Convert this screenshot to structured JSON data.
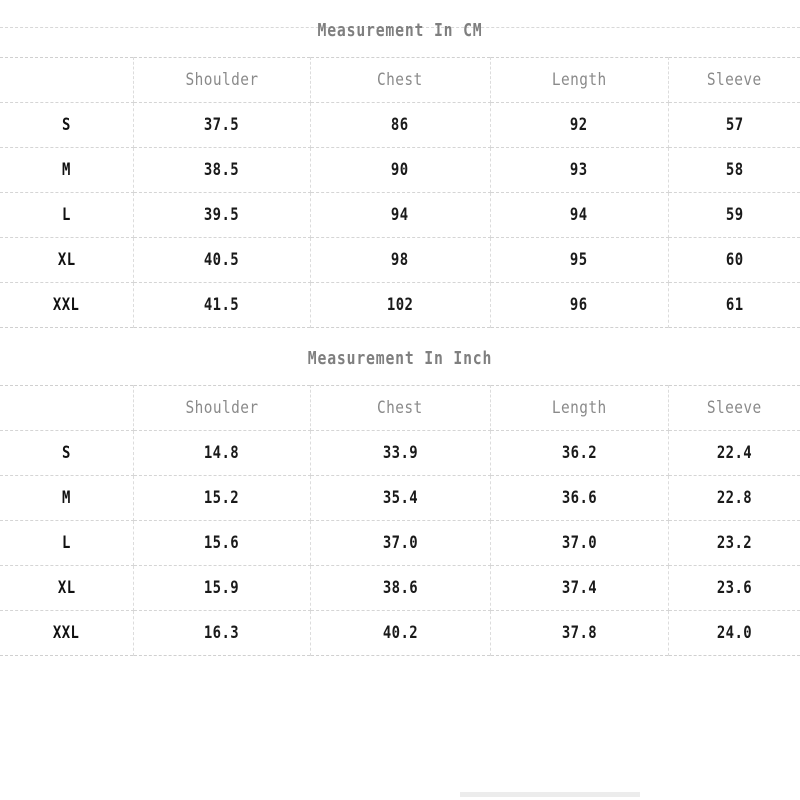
{
  "sections": [
    {
      "title": "Measurement In CM",
      "columns": [
        "",
        "Shoulder",
        "Chest",
        "Length",
        "Sleeve"
      ],
      "rows": [
        [
          "S",
          "37.5",
          "86",
          "92",
          "57"
        ],
        [
          "M",
          "38.5",
          "90",
          "93",
          "58"
        ],
        [
          "L",
          "39.5",
          "94",
          "94",
          "59"
        ],
        [
          "XL",
          "40.5",
          "98",
          "95",
          "60"
        ],
        [
          "XXL",
          "41.5",
          "102",
          "96",
          "61"
        ]
      ]
    },
    {
      "title": "Measurement In Inch",
      "columns": [
        "",
        "Shoulder",
        "Chest",
        "Length",
        "Sleeve"
      ],
      "rows": [
        [
          "S",
          "14.8",
          "33.9",
          "36.2",
          "22.4"
        ],
        [
          "M",
          "15.2",
          "35.4",
          "36.6",
          "22.8"
        ],
        [
          "L",
          "15.6",
          "37.0",
          "37.0",
          "23.2"
        ],
        [
          "XL",
          "15.9",
          "38.6",
          "37.4",
          "23.6"
        ],
        [
          "XXL",
          "16.3",
          "40.2",
          "37.8",
          "24.0"
        ]
      ]
    }
  ],
  "colors": {
    "title_text": "#7f7f7f",
    "header_text": "#8a8a8a",
    "value_text": "#1a1a1a",
    "grid_line": "#d5d5d5",
    "background": "#ffffff"
  }
}
